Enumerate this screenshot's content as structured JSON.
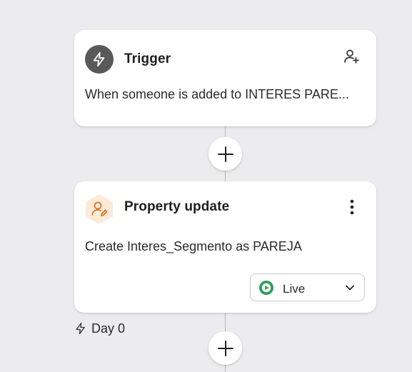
{
  "trigger_card": {
    "icon": "lightning-icon",
    "title": "Trigger",
    "description": "When someone is added to INTERES PARE...",
    "action_icon": "add-user-icon"
  },
  "add_step_buttons": [
    {
      "icon": "plus-icon"
    },
    {
      "icon": "plus-icon"
    }
  ],
  "property_card": {
    "icon": "user-edit-icon",
    "title": "Property update",
    "description": "Create Interes_Segmento as PAREJA",
    "menu_icon": "more-vertical-icon",
    "status": {
      "label": "Live",
      "icon": "play-circle-icon",
      "color": "#2e9e57"
    }
  },
  "delay": {
    "icon": "lightning-icon",
    "label": "Day 0"
  },
  "colors": {
    "background": "#ececee",
    "trigger_icon_bg": "#595959",
    "property_icon_bg": "#fdebd9",
    "property_icon_fg": "#e0711c",
    "live_green": "#2e9e57"
  }
}
